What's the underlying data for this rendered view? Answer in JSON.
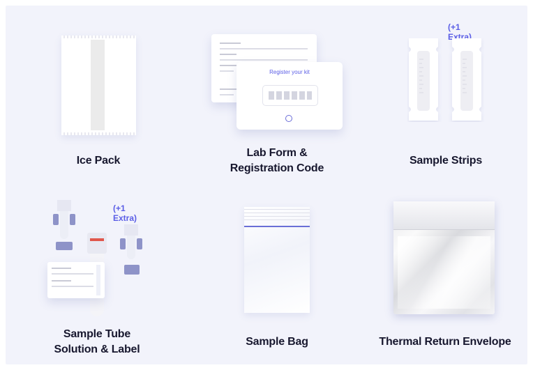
{
  "items": [
    {
      "label": "Ice Pack",
      "extra": ""
    },
    {
      "label_line1": "Lab Form &",
      "label_line2": "Registration Code",
      "card_title": "Register your kit"
    },
    {
      "label": "Sample Strips",
      "extra": "(+1 Extra)"
    },
    {
      "label_line1": "Sample Tube",
      "label_line2": "Solution & Label",
      "extra": "(+1 Extra)"
    },
    {
      "label": "Sample Bag"
    },
    {
      "label": "Thermal Return Envelope"
    }
  ],
  "colors": {
    "background": "#f2f3fb",
    "accent": "#5b5ee6",
    "text": "#17172e"
  }
}
